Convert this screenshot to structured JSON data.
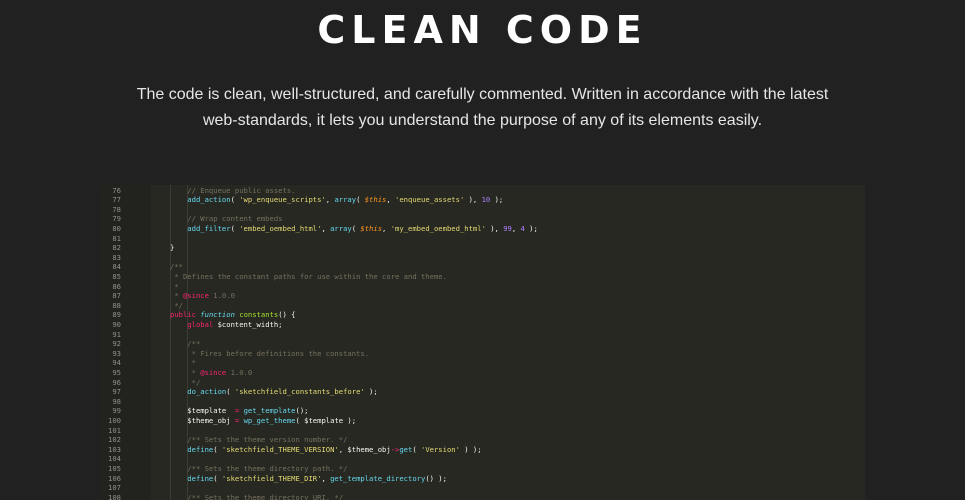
{
  "section": {
    "title": "CLEAN CODE",
    "description_line1": "The code is clean, well-structured, and carefully commented. Written in accordance with the latest",
    "description_line2": "web-standards, it lets you understand the purpose of any of its elements easily."
  },
  "editor": {
    "colors": {
      "background": "#272822",
      "comment": "#75715e",
      "function": "#66d9ef",
      "string": "#e6db74",
      "variable": "#fd971f",
      "number": "#ae81ff",
      "keyword": "#f92672",
      "plain": "#f8f8f2"
    },
    "lines": [
      {
        "num": "76",
        "indent": 2,
        "tokens": [
          [
            "c",
            "// Enqueue public assets."
          ]
        ]
      },
      {
        "num": "77",
        "indent": 2,
        "tokens": [
          [
            "f",
            "add_action"
          ],
          [
            "p",
            "( "
          ],
          [
            "s",
            "'wp_enqueue_scripts'"
          ],
          [
            "p",
            ", "
          ],
          [
            "f",
            "array"
          ],
          [
            "p",
            "( "
          ],
          [
            "v",
            "$this"
          ],
          [
            "p",
            ", "
          ],
          [
            "s",
            "'enqueue_assets'"
          ],
          [
            "p",
            " ), "
          ],
          [
            "n",
            "10"
          ],
          [
            "p",
            " );"
          ]
        ]
      },
      {
        "num": "78",
        "indent": 0,
        "tokens": []
      },
      {
        "num": "79",
        "indent": 2,
        "tokens": [
          [
            "c",
            "// Wrap content embeds"
          ]
        ]
      },
      {
        "num": "80",
        "indent": 2,
        "tokens": [
          [
            "f",
            "add_filter"
          ],
          [
            "p",
            "( "
          ],
          [
            "s",
            "'embed_oembed_html'"
          ],
          [
            "p",
            ", "
          ],
          [
            "f",
            "array"
          ],
          [
            "p",
            "( "
          ],
          [
            "v",
            "$this"
          ],
          [
            "p",
            ", "
          ],
          [
            "s",
            "'my_embed_oembed_html'"
          ],
          [
            "p",
            " ), "
          ],
          [
            "n",
            "99"
          ],
          [
            "p",
            ", "
          ],
          [
            "n",
            "4"
          ],
          [
            "p",
            " );"
          ]
        ]
      },
      {
        "num": "81",
        "indent": 0,
        "tokens": []
      },
      {
        "num": "82",
        "indent": 1,
        "tokens": [
          [
            "p",
            "}"
          ]
        ]
      },
      {
        "num": "83",
        "indent": 0,
        "tokens": []
      },
      {
        "num": "84",
        "indent": 1,
        "tokens": [
          [
            "c",
            "/**"
          ]
        ]
      },
      {
        "num": "85",
        "indent": 1,
        "tokens": [
          [
            "c",
            " * Defines the constant paths for use within the core and theme."
          ]
        ]
      },
      {
        "num": "86",
        "indent": 1,
        "tokens": [
          [
            "c",
            " *"
          ]
        ]
      },
      {
        "num": "87",
        "indent": 1,
        "tokens": [
          [
            "c",
            " * "
          ],
          [
            "k",
            "@since"
          ],
          [
            "c",
            " 1.0.0"
          ]
        ]
      },
      {
        "num": "88",
        "indent": 1,
        "tokens": [
          [
            "c",
            " */"
          ]
        ]
      },
      {
        "num": "89",
        "indent": 1,
        "tokens": [
          [
            "k",
            "public"
          ],
          [
            "p",
            " "
          ],
          [
            "i",
            "function"
          ],
          [
            "p",
            " "
          ],
          [
            "fn",
            "constants"
          ],
          [
            "p",
            "() {"
          ]
        ]
      },
      {
        "num": "90",
        "indent": 2,
        "tokens": [
          [
            "k",
            "global"
          ],
          [
            "p",
            " $content_width;"
          ]
        ]
      },
      {
        "num": "91",
        "indent": 0,
        "tokens": []
      },
      {
        "num": "92",
        "indent": 2,
        "tokens": [
          [
            "c",
            "/**"
          ]
        ]
      },
      {
        "num": "93",
        "indent": 2,
        "tokens": [
          [
            "c",
            " * Fires before definitions the constants."
          ]
        ]
      },
      {
        "num": "94",
        "indent": 2,
        "tokens": [
          [
            "c",
            " *"
          ]
        ]
      },
      {
        "num": "95",
        "indent": 2,
        "tokens": [
          [
            "c",
            " * "
          ],
          [
            "k",
            "@since"
          ],
          [
            "c",
            " 1.0.0"
          ]
        ]
      },
      {
        "num": "96",
        "indent": 2,
        "tokens": [
          [
            "c",
            " */"
          ]
        ]
      },
      {
        "num": "97",
        "indent": 2,
        "tokens": [
          [
            "f",
            "do_action"
          ],
          [
            "p",
            "( "
          ],
          [
            "s",
            "'sketchfield_constants_before'"
          ],
          [
            "p",
            " );"
          ]
        ]
      },
      {
        "num": "98",
        "indent": 0,
        "tokens": []
      },
      {
        "num": "99",
        "indent": 2,
        "tokens": [
          [
            "p",
            "$template  "
          ],
          [
            "k",
            "="
          ],
          [
            "p",
            " "
          ],
          [
            "f",
            "get_template"
          ],
          [
            "p",
            "();"
          ]
        ]
      },
      {
        "num": "100",
        "indent": 2,
        "tokens": [
          [
            "p",
            "$theme_obj "
          ],
          [
            "k",
            "="
          ],
          [
            "p",
            " "
          ],
          [
            "f",
            "wp_get_theme"
          ],
          [
            "p",
            "( $template );"
          ]
        ]
      },
      {
        "num": "101",
        "indent": 0,
        "tokens": []
      },
      {
        "num": "102",
        "indent": 2,
        "tokens": [
          [
            "c",
            "/** Sets the theme version number. */"
          ]
        ]
      },
      {
        "num": "103",
        "indent": 2,
        "tokens": [
          [
            "f",
            "define"
          ],
          [
            "p",
            "( "
          ],
          [
            "s",
            "'sketchfield_THEME_VERSION'"
          ],
          [
            "p",
            ", $theme_obj"
          ],
          [
            "k",
            "->"
          ],
          [
            "f",
            "get"
          ],
          [
            "p",
            "( "
          ],
          [
            "s",
            "'Version'"
          ],
          [
            "p",
            " ) );"
          ]
        ]
      },
      {
        "num": "104",
        "indent": 0,
        "tokens": []
      },
      {
        "num": "105",
        "indent": 2,
        "tokens": [
          [
            "c",
            "/** Sets the theme directory path. */"
          ]
        ]
      },
      {
        "num": "106",
        "indent": 2,
        "tokens": [
          [
            "f",
            "define"
          ],
          [
            "p",
            "( "
          ],
          [
            "s",
            "'sketchfield_THEME_DIR'"
          ],
          [
            "p",
            ", "
          ],
          [
            "f",
            "get_template_directory"
          ],
          [
            "p",
            "() );"
          ]
        ]
      },
      {
        "num": "107",
        "indent": 0,
        "tokens": []
      },
      {
        "num": "108",
        "indent": 2,
        "tokens": [
          [
            "c",
            "/** Sets the theme directory URI. */"
          ]
        ]
      }
    ]
  }
}
